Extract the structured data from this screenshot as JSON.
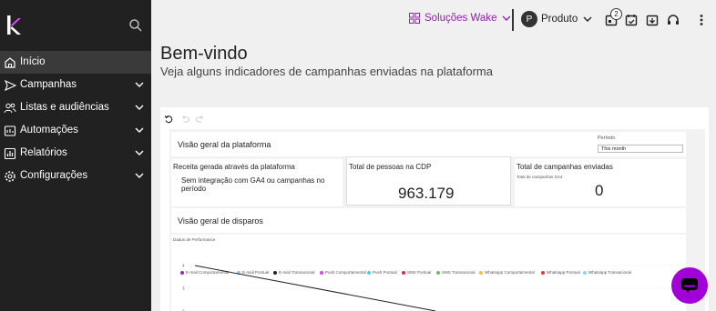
{
  "sidebar": {
    "items": [
      {
        "label": "Início",
        "icon": "home-icon",
        "active": true
      },
      {
        "label": "Campanhas",
        "icon": "send-icon"
      },
      {
        "label": "Listas e audiências",
        "icon": "people-icon"
      },
      {
        "label": "Automações",
        "icon": "automation-icon"
      },
      {
        "label": "Relatórios",
        "icon": "report-icon"
      },
      {
        "label": "Configurações",
        "icon": "gear-icon"
      }
    ]
  },
  "topbar": {
    "solutions_label": "Soluções Wake",
    "avatar_letter": "P",
    "product_label": "Produto",
    "notification_count": "2",
    "accent": "#8e24aa"
  },
  "page": {
    "title": "Bem-vindo",
    "subtitle": "Veja alguns indicadores de campanhas enviadas na plataforma"
  },
  "dashboard": {
    "overview_title": "Visão geral da plataforma",
    "period_label": "Período",
    "period_value": "This month",
    "revenue_title": "Receita gerada através da plataforma",
    "revenue_message": "Sem integração com GA4 ou campanhas no período",
    "cdp_title": "Total de pessoas na CDP",
    "cdp_value": "963.179",
    "campaigns_title": "Total de campanhas enviadas",
    "campaigns_sub": "Total de campanhas GA4",
    "campaigns_value": "0",
    "sends_title": "Visão geral de disparos",
    "performance_label": "Dados de Performance",
    "legend": [
      {
        "label": "E-mail Comportamental",
        "color": "#9c27b0"
      },
      {
        "label": "E-mail Pontual",
        "color": "#90caf9"
      },
      {
        "label": "E-mail Transacional",
        "color": "#212121"
      },
      {
        "label": "Push Comportamental",
        "color": "#e040fb"
      },
      {
        "label": "Push Pontual",
        "color": "#4dd0e1"
      },
      {
        "label": "SMS Pontual",
        "color": "#e91e63"
      },
      {
        "label": "SMS Transacional",
        "color": "#66bb6a"
      },
      {
        "label": "Whatsapp Comportamental",
        "color": "#ffb74d"
      },
      {
        "label": "Whatsapp Pontual",
        "color": "#e53935"
      },
      {
        "label": "Whatsapp Transacional",
        "color": "#80deea"
      }
    ]
  },
  "chart_data": {
    "type": "line",
    "title": "",
    "y_ticks": [
      "4",
      "3",
      "2"
    ],
    "series": [
      {
        "name": "E-mail Transacional",
        "x": [
          0,
          1
        ],
        "values": [
          4,
          2
        ]
      }
    ]
  }
}
